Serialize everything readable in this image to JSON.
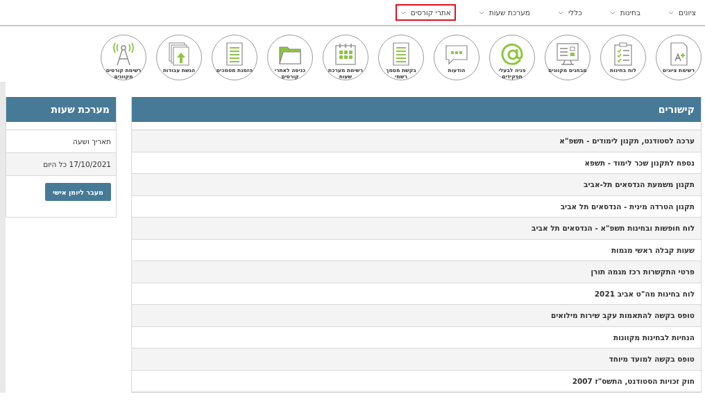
{
  "nav": [
    {
      "label": "ציונים",
      "selected": false
    },
    {
      "label": "בחינות",
      "selected": false
    },
    {
      "label": "כללי",
      "selected": false
    },
    {
      "label": "מערכת שעות",
      "selected": false
    },
    {
      "label": "אתרי קורסים",
      "selected": true
    }
  ],
  "shortcuts": [
    "רשימת ציונים",
    "לוח בחינות",
    "מבחנים מקוונים",
    "פניה לבעלי תפקידים",
    "הודעות",
    "בקשת מסמך רשמי",
    "רשימת מערכת שעות",
    "כניסה לאתרי קורסים",
    "הזמנת מסמכים",
    "הגשת עבודות",
    "רשימת קורסים מקוונים"
  ],
  "links": {
    "title": "קישורים",
    "items": [
      "ערכה לסטודנט, תקנון לימודים - תשפ\"א",
      "נספח לתקנון שכר לימוד - תשפא",
      "תקנון משמעת הנדסאים תל-אביב",
      "תקנון הטרדה מינית - הנדסאים תל אביב",
      "לוח חופשות ובחינות תשפ\"א - הנדסאים תל אביב",
      "שעות קבלה ראשי מגמות",
      "פרטי התקשרות רכז מגמה תורן",
      "לוח בחינות מה\"ט אביב 2021",
      "טופס בקשה להתאמות עקב שירות מילואים",
      "הנחיות לבחינות מקוונות",
      "טופס בקשה למועד מיוחד",
      "חוק זכויות הסטודנט, התשס\"ז 2007"
    ]
  },
  "schedule": {
    "title": "מערכת שעות",
    "column_header": "תאריך ושעה",
    "entry": "17/10/2021 כל היום",
    "button": "מעבר ליומן אישי"
  }
}
